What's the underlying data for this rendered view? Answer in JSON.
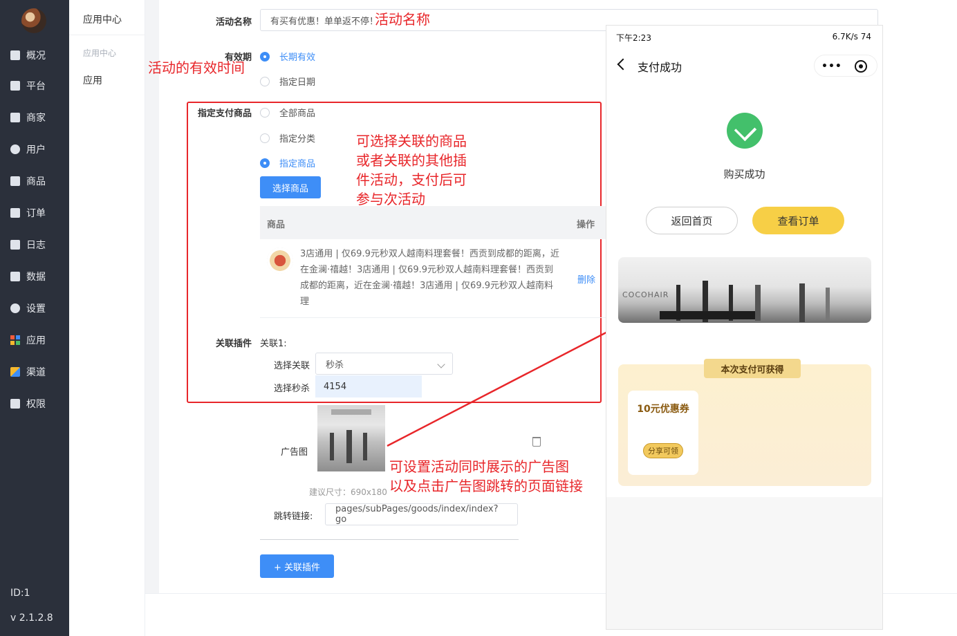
{
  "sidebar": {
    "items": [
      {
        "label": "概况",
        "icon": "dashboard-icon"
      },
      {
        "label": "平台",
        "icon": "monitor-icon"
      },
      {
        "label": "商家",
        "icon": "store-icon"
      },
      {
        "label": "用户",
        "icon": "user-icon"
      },
      {
        "label": "商品",
        "icon": "goods-icon"
      },
      {
        "label": "订单",
        "icon": "order-icon"
      },
      {
        "label": "日志",
        "icon": "log-icon"
      },
      {
        "label": "数据",
        "icon": "chart-icon"
      },
      {
        "label": "设置",
        "icon": "gear-icon"
      },
      {
        "label": "应用",
        "icon": "apps-icon"
      },
      {
        "label": "渠道",
        "icon": "cube-icon"
      },
      {
        "label": "权限",
        "icon": "lock-icon"
      }
    ],
    "id_text": "ID:1",
    "version": "v 2.1.2.8"
  },
  "subnav": {
    "title": "应用中心",
    "group": "应用中心",
    "item": "应用"
  },
  "form": {
    "activity_name_label": "活动名称",
    "activity_name_value": "有买有优惠！单单返不停！",
    "validity_label": "有效期",
    "validity_options": [
      "长期有效",
      "指定日期"
    ],
    "pay_goods_label": "指定支付商品",
    "pay_goods_options": [
      "全部商品",
      "指定分类",
      "指定商品"
    ],
    "select_goods_button": "选择商品",
    "table_header_goods": "商品",
    "table_header_action": "操作",
    "goods_desc": "3店通用 | 仅69.9元秒双人越南料理套餐！西贡到成都的距离，近在金澜·禧越！3店通用 | 仅69.9元秒双人越南料理套餐！西贡到成都的距离，近在金澜·禧越！3店通用 | 仅69.9元秒双人越南料理",
    "delete_link": "删除",
    "plugin_label": "关联插件",
    "plugin_index": "关联1:",
    "select_assoc_label": "选择关联",
    "select_assoc_value": "秒杀",
    "select_seckill_label": "选择秒杀",
    "select_seckill_value": "4154",
    "ad_label": "广告图",
    "ad_hint": "建议尺寸：690x180",
    "jump_label": "跳转链接:",
    "jump_value": "pages/subPages/goods/index/index?go",
    "add_plugin_button": "+ 关联插件"
  },
  "annotations": {
    "name": "活动名称",
    "validity": "活动的有效时间",
    "goods": [
      "可选择关联的商品",
      "或者关联的其他插",
      "件活动，支付后可",
      "参与次活动"
    ],
    "ad": [
      "可设置活动同时展示的广告图",
      "以及点击广告图跳转的页面链接"
    ]
  },
  "phone": {
    "status_time": "下午2:23",
    "status_right": "6.7K/s  74",
    "nav_title": "支付成功",
    "success_text": "购买成功",
    "home_button": "返回首页",
    "order_button": "查看订单",
    "banner_brand": "COCOHAIR",
    "reward_title": "本次支付可获得",
    "coupon_amount": "10元优惠券",
    "coupon_share": "分享可领"
  },
  "colors": {
    "sidebar_bg": "#2b303b",
    "accent": "#3e8ef7",
    "annotation_red": "#e8262a",
    "success_green": "#43c06b",
    "phone_yellow": "#f7cf46"
  }
}
